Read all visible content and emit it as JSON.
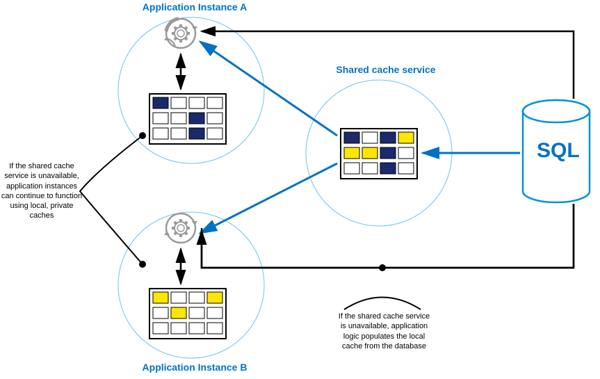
{
  "labels": {
    "instanceA": "Application Instance A",
    "instanceB": "Application Instance B",
    "sharedCache": "Shared cache service",
    "sql": "SQL"
  },
  "annotations": {
    "left": "If the shared cache service is unavailable, application instances can continue to function using local, private caches",
    "bottom": "If the shared cache service is unavailable, application logic populates the local cache from the database"
  },
  "chart_data": {
    "type": "diagram",
    "nodes": [
      {
        "id": "instanceA",
        "label": "Application Instance A",
        "type": "app-instance",
        "hasGear": true,
        "hasGrid": true
      },
      {
        "id": "instanceB",
        "label": "Application Instance B",
        "type": "app-instance",
        "hasGear": true,
        "hasGrid": true
      },
      {
        "id": "sharedCache",
        "label": "Shared cache service",
        "type": "cache",
        "hasGrid": true
      },
      {
        "id": "sql",
        "label": "SQL",
        "type": "database"
      }
    ],
    "edges": [
      {
        "from": "sql",
        "to": "sharedCache",
        "style": "blue-arrow"
      },
      {
        "from": "sharedCache",
        "to": "instanceA",
        "style": "blue-arrow"
      },
      {
        "from": "sharedCache",
        "to": "instanceB",
        "style": "blue-arrow"
      },
      {
        "from": "sql",
        "to": "instanceA",
        "style": "black-arrow"
      },
      {
        "from": "sql",
        "to": "instanceB",
        "style": "black-arrow"
      },
      {
        "from": "gearA",
        "to": "gridA",
        "style": "double-arrow"
      },
      {
        "from": "gearB",
        "to": "gridB",
        "style": "double-arrow"
      }
    ],
    "gridFills": {
      "instanceA": {
        "darkBlue": [
          [
            0,
            0
          ],
          [
            1,
            2
          ],
          [
            2,
            2
          ]
        ],
        "cols": 4,
        "rows": 3
      },
      "instanceB": {
        "yellow": [
          [
            0,
            0
          ],
          [
            0,
            3
          ],
          [
            1,
            1
          ]
        ],
        "cols": 4,
        "rows": 3
      },
      "sharedCache": {
        "darkBlue": [
          [
            0,
            0
          ],
          [
            0,
            2
          ],
          [
            1,
            2
          ],
          [
            2,
            2
          ]
        ],
        "yellow": [
          [
            0,
            3
          ],
          [
            1,
            0
          ],
          [
            1,
            1
          ]
        ],
        "cols": 4,
        "rows": 3
      }
    },
    "annotations": [
      {
        "id": "left",
        "text": "If the shared cache service is unavailable, application instances can continue to function using local, private caches",
        "connects": [
          "instanceA",
          "instanceB"
        ]
      },
      {
        "id": "bottom",
        "text": "If the shared cache service is unavailable, application logic populates the local cache from the database",
        "connects": [
          "sql-to-instance-path"
        ]
      }
    ]
  }
}
